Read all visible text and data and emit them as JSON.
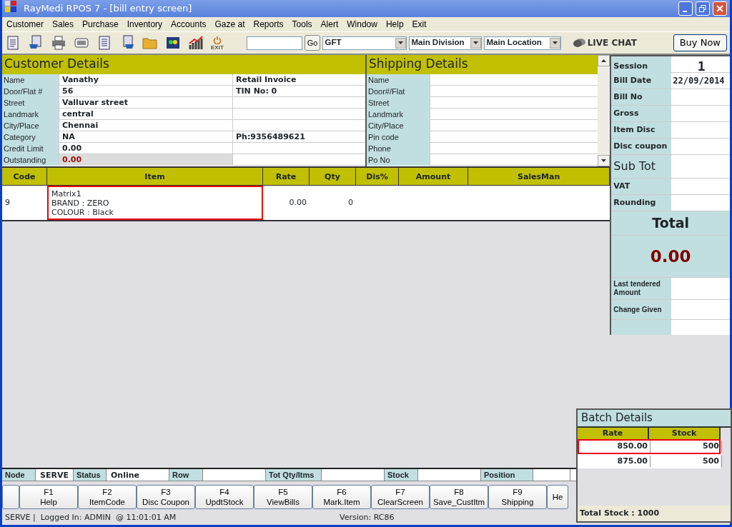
{
  "window": {
    "title": "RayMedi RPOS 7 - [bill entry screen]"
  },
  "menu": [
    "Customer",
    "Sales",
    "Purchase",
    "Inventory",
    "Accounts",
    "Gaze at",
    "Reports",
    "Tools",
    "Alert",
    "Window",
    "Help",
    "Exit"
  ],
  "toolbar": {
    "exit_label": "EXIT",
    "go_label": "Go",
    "selects": [
      "GFT",
      "Main Division",
      "Main Location"
    ],
    "live_chat": "LIVE CHAT",
    "buy_now": "Buy Now"
  },
  "customer": {
    "title": "Customer Details",
    "rows": [
      {
        "label": "Name",
        "value": "Vanathy",
        "extra": "Retail Invoice",
        "kind": "normal"
      },
      {
        "label": "Door/Flat #",
        "value": "56",
        "extra": "TIN No: 0",
        "kind": "normal"
      },
      {
        "label": "Street",
        "value": "Valluvar street",
        "kind": "normal"
      },
      {
        "label": "Landmark",
        "value": "central",
        "kind": "normal"
      },
      {
        "label": "City/Place",
        "value": "Chennai",
        "kind": "normal"
      },
      {
        "label": "Category",
        "value": "NA",
        "extra": "Ph:9356489621",
        "kind": "normal"
      },
      {
        "label": "Credit Limit",
        "value": "0.00",
        "kind": "normal"
      },
      {
        "label": "Outstanding",
        "value": "0.00",
        "kind": "alert"
      }
    ]
  },
  "shipping": {
    "title": "Shipping Details",
    "fields": [
      "Name",
      "Door#/Flat",
      "Street",
      "Landmark",
      "City/Place",
      "Pin code",
      "Phone",
      "Po No"
    ]
  },
  "items": {
    "columns": [
      "Code",
      "Item",
      "Rate",
      "Qty",
      "Dis%",
      "Amount",
      "SalesMan"
    ],
    "rows": [
      {
        "code": "9",
        "item_lines": [
          "Matrix1",
          "BRAND : ZERO",
          "COLOUR : Black"
        ],
        "rate": "0.00",
        "qty": "0",
        "selected": true
      }
    ]
  },
  "summary": {
    "rows": [
      {
        "label": "Session",
        "value": "1",
        "kind": "session"
      },
      {
        "label": "Bill Date",
        "value": "22/09/2014",
        "kind": "normal"
      },
      {
        "label": "Bill No",
        "kind": "normal"
      },
      {
        "label": "Gross",
        "kind": "normal"
      },
      {
        "label": "Item Disc",
        "kind": "normal"
      },
      {
        "label": "Disc coupon",
        "kind": "normal"
      },
      {
        "label": "Sub Tot",
        "kind": "large"
      },
      {
        "label": "VAT",
        "kind": "normal"
      },
      {
        "label": "Rounding",
        "kind": "normal"
      }
    ],
    "total_label": "Total",
    "total_value": "0.00",
    "after": [
      {
        "label": "Last tendered Amount"
      },
      {
        "label": "Change Given"
      }
    ]
  },
  "status_strip": [
    {
      "label": "Node",
      "value": "SERVE"
    },
    {
      "label": "Status",
      "value": "Online"
    },
    {
      "label": "Row"
    },
    {
      "label": "Tot Qty/Itms"
    },
    {
      "label": "Stock"
    },
    {
      "label": "Position"
    }
  ],
  "function_keys": [
    {
      "key": "F1",
      "label": "Help"
    },
    {
      "key": "F2",
      "label": "ItemCode"
    },
    {
      "key": "F3",
      "label": "Disc Coupon"
    },
    {
      "key": "F4",
      "label": "UpdtStock"
    },
    {
      "key": "F5",
      "label": "ViewBills"
    },
    {
      "key": "F6",
      "label": "Mark.Item"
    },
    {
      "key": "F7",
      "label": "ClearScreen"
    },
    {
      "key": "F8",
      "label": "Save_CustItm"
    },
    {
      "key": "F9",
      "label": "Shipping"
    },
    {
      "label": "He"
    }
  ],
  "status_bar": {
    "left": "SERVE |  Logged In: ADMIN  @ 11:01:01 AM",
    "version": "Version: RC86"
  },
  "batch": {
    "title": "Batch Details",
    "columns": [
      "Rate",
      "Stock"
    ],
    "rows": [
      {
        "rate": "850.00",
        "stock": "500",
        "selected": true
      },
      {
        "rate": "875.00",
        "stock": "500",
        "selected": false
      }
    ],
    "total": "Total Stock : 1000"
  }
}
